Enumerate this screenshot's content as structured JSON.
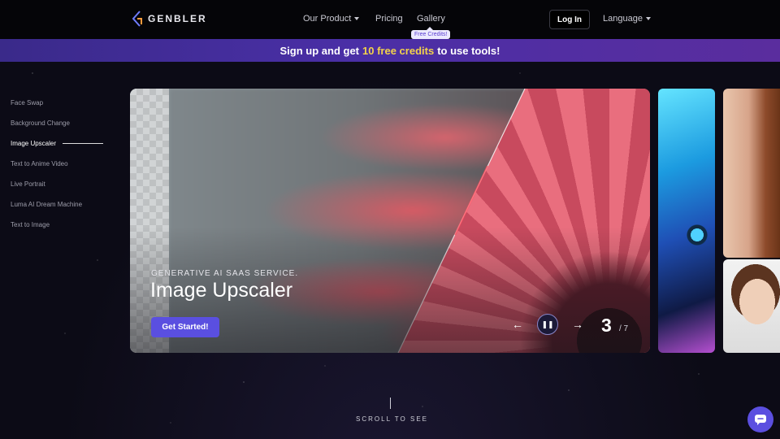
{
  "brand": {
    "name": "GENBLER"
  },
  "nav": {
    "our_product": "Our Product",
    "pricing": "Pricing",
    "gallery": "Gallery",
    "free_credits_badge": "Free Credits!",
    "login": "Log In",
    "language": "Language"
  },
  "banner": {
    "prefix": "Sign up and get",
    "highlight": "10 free credits",
    "suffix": "to use tools!",
    "highlight_color": "#f3d34a"
  },
  "sidebar": {
    "items": [
      {
        "label": "Face Swap"
      },
      {
        "label": "Background Change"
      },
      {
        "label": "Image Upscaler",
        "active": true
      },
      {
        "label": "Text to Anime Video"
      },
      {
        "label": "Live Portrait"
      },
      {
        "label": "Luma AI Dream Machine"
      },
      {
        "label": "Text to Image"
      }
    ]
  },
  "hero": {
    "kicker": "GENERATIVE AI SAAS SERVICE.",
    "title": "Image Upscaler",
    "cta": "Get Started!",
    "prev_icon": "arrow-left-icon",
    "next_icon": "arrow-right-icon",
    "pause_icon": "pause-icon",
    "current": "3",
    "total": "/ 7",
    "accent_color": "#5a4fe0"
  },
  "scroll": {
    "label": "SCROLL TO SEE"
  },
  "chat": {
    "icon": "chat-icon"
  }
}
